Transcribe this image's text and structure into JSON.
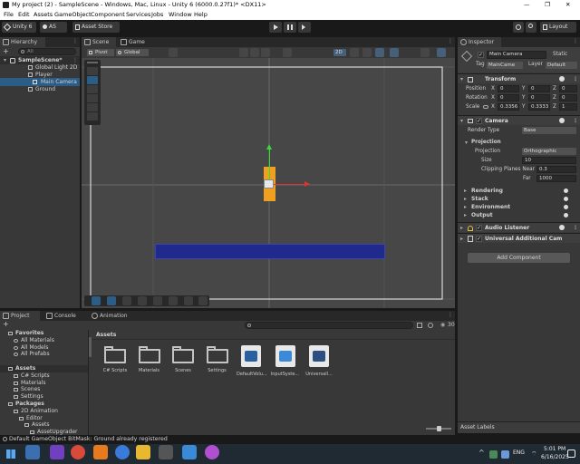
{
  "window": {
    "title": "My project (2) - SampleScene - Windows, Mac, Linux - Unity 6 (6000.0.27f1)* <DX11>",
    "minimize": "—",
    "maximize": "❐",
    "close": "✕"
  },
  "menu": [
    "File",
    "Edit",
    "Assets",
    "GameObject",
    "Component",
    "Services",
    "Jobs",
    "Window",
    "Help"
  ],
  "toolbar": {
    "account": "Unity 6",
    "user": "AS",
    "store": "Asset Store",
    "layout": "Layout"
  },
  "hierarchy": {
    "tab": "Hierarchy",
    "search_placeholder": "All",
    "items": [
      {
        "label": "SampleScene*"
      },
      {
        "label": "Global Light 2D"
      },
      {
        "label": "Player"
      },
      {
        "label": "Main Camera"
      },
      {
        "label": "Ground"
      }
    ]
  },
  "scene": {
    "tabs": [
      "Scene",
      "Game"
    ],
    "pivot": "Pivot",
    "global": "Global",
    "mode2d": "2D"
  },
  "inspector": {
    "tab": "Inspector",
    "object_name": "Main Camera",
    "static": "Static",
    "tag_label": "Tag",
    "tag": "MainCame",
    "layer_label": "Layer",
    "layer": "Default",
    "transform": {
      "title": "Transform",
      "position": {
        "label": "Position",
        "x": "0",
        "y": "0",
        "z": "0"
      },
      "rotation": {
        "label": "Rotation",
        "x": "0",
        "y": "0",
        "z": "0"
      },
      "scale": {
        "label": "Scale",
        "x": "0.3356",
        "y": "0.3333",
        "z": "1"
      }
    },
    "camera": {
      "title": "Camera",
      "render_type_label": "Render Type",
      "render_type": "Base",
      "projection_header": "Projection",
      "projection_label": "Projection",
      "projection": "Orthographic",
      "size_label": "Size",
      "size": "10",
      "near_label": "Clipping Planes Near",
      "near": "0.3",
      "far_label": "Far",
      "far": "1000",
      "rendering": "Rendering",
      "stack": "Stack",
      "environment": "Environment",
      "output": "Output"
    },
    "audio_listener": "Audio Listener",
    "universal": "Universal Additional Cam",
    "add_component": "Add Component",
    "axis": {
      "x": "X",
      "y": "Y",
      "z": "Z"
    }
  },
  "project": {
    "tabs": [
      "Project",
      "Console",
      "Animation"
    ],
    "count": "30",
    "tree": [
      {
        "label": "Favorites",
        "indent": 0,
        "bold": true
      },
      {
        "label": "All Materials",
        "indent": 1
      },
      {
        "label": "All Models",
        "indent": 1
      },
      {
        "label": "All Prefabs",
        "indent": 1
      },
      {
        "label": "",
        "indent": 0
      },
      {
        "label": "Assets",
        "indent": 0,
        "bold": true
      },
      {
        "label": "C# Scripts",
        "indent": 1
      },
      {
        "label": "Materials",
        "indent": 1
      },
      {
        "label": "Scenes",
        "indent": 1
      },
      {
        "label": "Settings",
        "indent": 1
      },
      {
        "label": "Packages",
        "indent": 0,
        "bold": true
      },
      {
        "label": "2D Animation",
        "indent": 1
      },
      {
        "label": "Editor",
        "indent": 2
      },
      {
        "label": "Assets",
        "indent": 3
      },
      {
        "label": "AssetUpgrader",
        "indent": 4
      }
    ],
    "breadcrumb": "Assets",
    "assets": [
      {
        "label": "C# Scripts",
        "kind": "folder"
      },
      {
        "label": "Materials",
        "kind": "folder"
      },
      {
        "label": "Scenes",
        "kind": "folder"
      },
      {
        "label": "Settings",
        "kind": "folder"
      },
      {
        "label": "DefaultVolu...",
        "kind": "volume"
      },
      {
        "label": "InputSyste...",
        "kind": "input"
      },
      {
        "label": "Universall...",
        "kind": "urp"
      }
    ]
  },
  "asset_labels": "Asset Labels",
  "status": "Default GameObject BitMask: Ground already registered",
  "taskbar": {
    "lang": "ENG",
    "time": "5:01 PM",
    "date": "6/16/2025"
  },
  "colors": {
    "accent": "#2c5d87",
    "ground": "#1f2a8c",
    "player": "#f0a020"
  }
}
